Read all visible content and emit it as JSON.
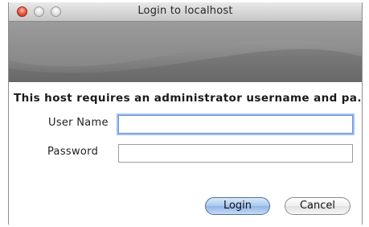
{
  "window": {
    "title": "Login to localhost"
  },
  "dialog": {
    "message": "This host requires an administrator username and pa..."
  },
  "form": {
    "username_label": "User Name",
    "username_value": "",
    "password_label": "Password",
    "password_value": ""
  },
  "buttons": {
    "login_label": "Login",
    "cancel_label": "Cancel"
  },
  "colors": {
    "close_button": "#e8543d",
    "focus_ring": "#9fc0ef",
    "default_button": "#a9c8ee"
  }
}
